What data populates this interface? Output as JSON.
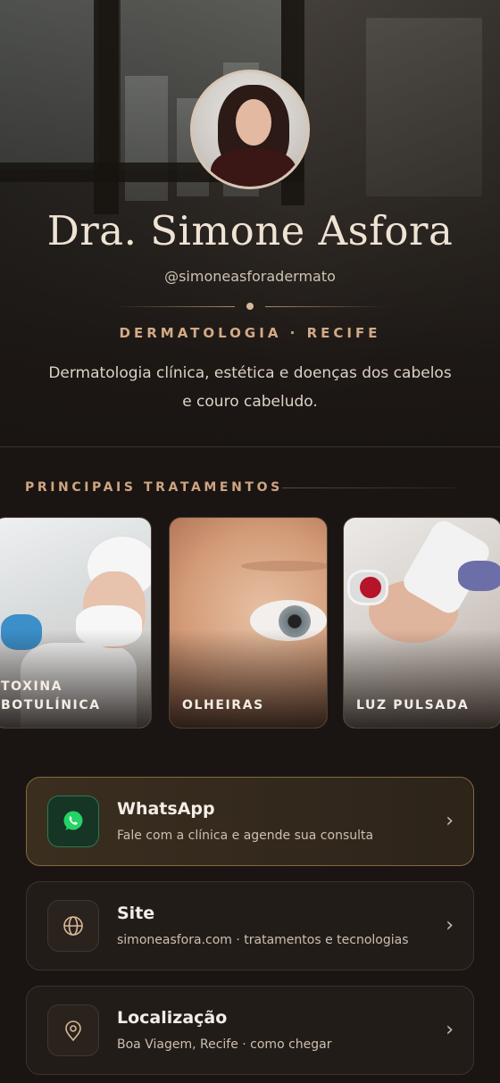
{
  "profile": {
    "name": "Dra. Simone Asfora",
    "handle": "@simoneasforadermato",
    "specialty": "DERMATOLOGIA · RECIFE",
    "bio": "Dermatologia clínica, estética e doenças dos cabelos e couro cabeludo."
  },
  "treatments": {
    "section_title": "PRINCIPAIS TRATAMENTOS",
    "items": [
      {
        "label_line1": "TOXINA",
        "label_line2": "BOTULÍNICA"
      },
      {
        "label_line1": "OLHEIRAS",
        "label_line2": ""
      },
      {
        "label_line1": "LUZ PULSADA",
        "label_line2": ""
      }
    ]
  },
  "links": [
    {
      "title": "WhatsApp",
      "subtitle": "Fale com a clínica e agende sua consulta",
      "icon": "whatsapp-icon",
      "chevron": "›"
    },
    {
      "title": "Site",
      "subtitle": "simoneasfora.com · tratamentos e tecnologias",
      "icon": "globe-icon",
      "chevron": "›"
    },
    {
      "title": "Localização",
      "subtitle": "Boa Viagem, Recife · como chegar",
      "icon": "location-pin-icon",
      "chevron": "›"
    }
  ],
  "colors": {
    "background": "#1a1512",
    "accent_gold": "#d3aa86",
    "whatsapp_green": "#25d366"
  }
}
